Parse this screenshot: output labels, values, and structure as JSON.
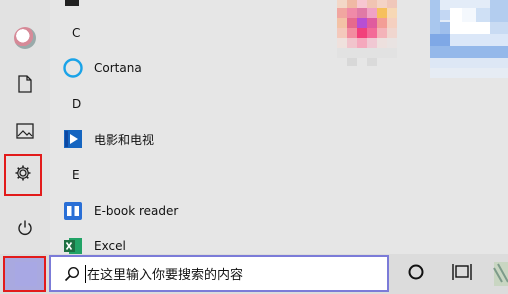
{
  "start_menu": {
    "letters": [
      "C",
      "D",
      "E"
    ],
    "apps": [
      {
        "label": "Cortana",
        "icon": "cortana-icon"
      },
      {
        "label": "电影和电视",
        "icon": "movies-tv-icon"
      },
      {
        "label": "E-book reader",
        "icon": "ebook-reader-icon"
      },
      {
        "label": "Excel",
        "icon": "excel-icon"
      }
    ]
  },
  "rail": {
    "items": [
      "avatar",
      "documents-icon",
      "pictures-icon",
      "settings-icon",
      "power-icon"
    ]
  },
  "taskbar": {
    "search_placeholder": "在这里输入你要搜索的内容",
    "icons": [
      "search-icon",
      "cortana-circle-icon",
      "task-view-icon"
    ]
  },
  "colors": {
    "highlight_border": "#e21b1b",
    "search_border": "#7b7bd8",
    "cortana_ring": "#1aa3e8",
    "excel_green": "#1d6f42"
  }
}
